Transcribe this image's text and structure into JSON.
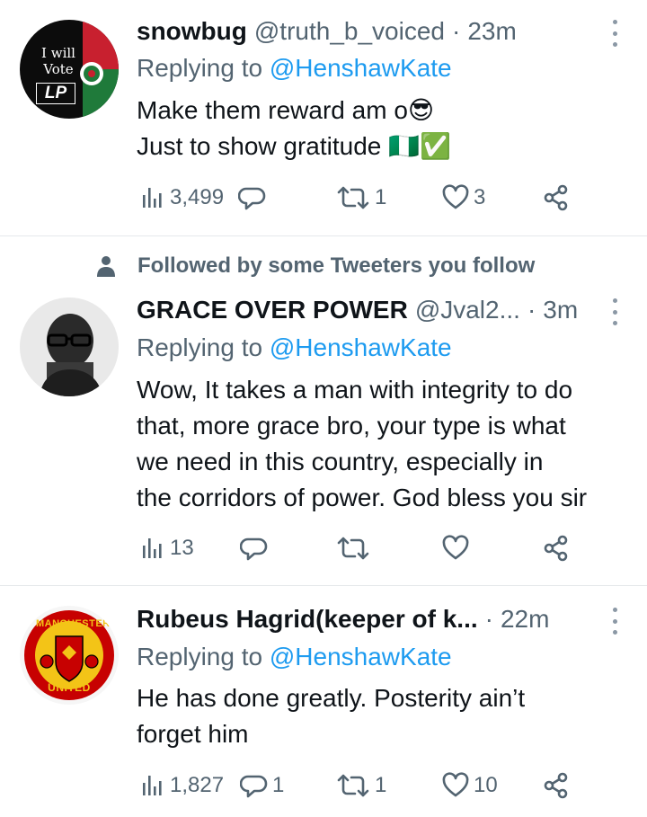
{
  "tweets": [
    {
      "name": "snowbug",
      "handle": "@truth_b_voiced",
      "separator": "·",
      "time": "23m",
      "replying_prefix": "Replying to ",
      "replying_handle": "@HenshawKate",
      "lines": [
        "Make them reward am o😎",
        "Just to show gratitude 🇳🇬✅"
      ],
      "avatar_text": [
        "I will",
        "Vote",
        "LP"
      ],
      "views": "3,499",
      "replies": "",
      "retweets": "1",
      "likes": "3"
    },
    {
      "social_context": "Followed by some Tweeters you follow",
      "name": "GRACE OVER POWER",
      "handle": "@Jval2...",
      "separator": "·",
      "time": "3m",
      "replying_prefix": "Replying to ",
      "replying_handle": "@HenshawKate",
      "lines": [
        "Wow, It takes a man with integrity to do",
        "that, more grace bro, your type is what",
        "we need in this country, especially in",
        "the corridors of power. God bless you sir"
      ],
      "views": "13",
      "replies": "",
      "retweets": "",
      "likes": ""
    },
    {
      "name": "Rubeus Hagrid(keeper of k...",
      "handle": "",
      "separator": "·",
      "time": "22m",
      "replying_prefix": "Replying to ",
      "replying_handle": "@HenshawKate",
      "lines": [
        "He has done greatly. Posterity ain’t",
        "forget him"
      ],
      "avatar_text": [
        "MANCHESTER",
        "UNITED"
      ],
      "views": "1,827",
      "replies": "1",
      "retweets": "1",
      "likes": "10"
    }
  ],
  "colors": {
    "text": "#0f1419",
    "secondary": "#536471",
    "link": "#1d9bf0",
    "divider": "#e5e8eb",
    "lp_green": "#1f7a3a",
    "lp_red": "#c8202f",
    "manutd_red": "#c70101",
    "manutd_gold": "#f3c417"
  },
  "icons": [
    "views-icon",
    "reply-icon",
    "retweet-icon",
    "like-icon",
    "share-icon",
    "more-icon",
    "person-icon"
  ]
}
